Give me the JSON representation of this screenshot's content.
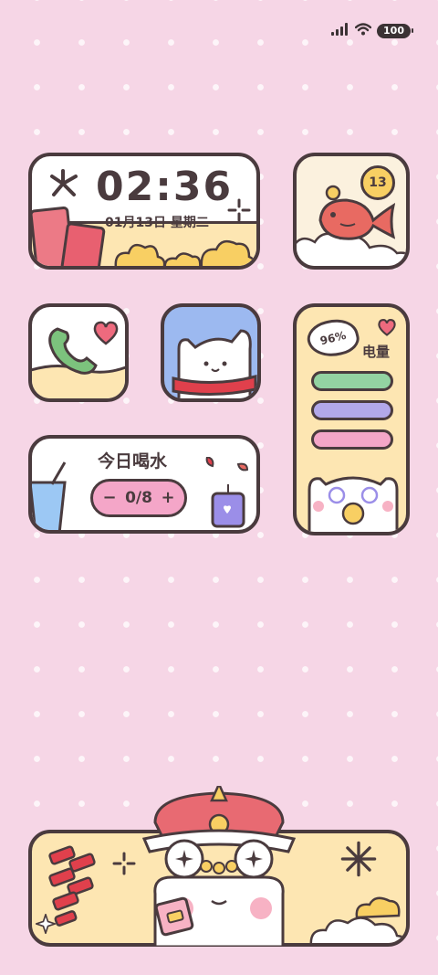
{
  "status_bar": {
    "battery_level": "100",
    "signal_icon": "signal-icon",
    "wifi_icon": "wifi-icon"
  },
  "clock_widget": {
    "time": "02:36",
    "date": "01月13日 星期二"
  },
  "fortune_widget": {
    "badge_number": "13"
  },
  "water_widget": {
    "title": "今日喝水",
    "minus_label": "−",
    "count": "0/8",
    "plus_label": "+"
  },
  "battery_widget": {
    "percent": "96%",
    "label": "电量",
    "bar_colors": [
      "#93d3a2",
      "#b2a8ea",
      "#f4a6c8"
    ]
  },
  "colors": {
    "background": "#f6d6e6",
    "outline": "#4a3b3e",
    "cream": "#fde6b2",
    "pink": "#f4a6c8",
    "yellow": "#f8cf63"
  }
}
